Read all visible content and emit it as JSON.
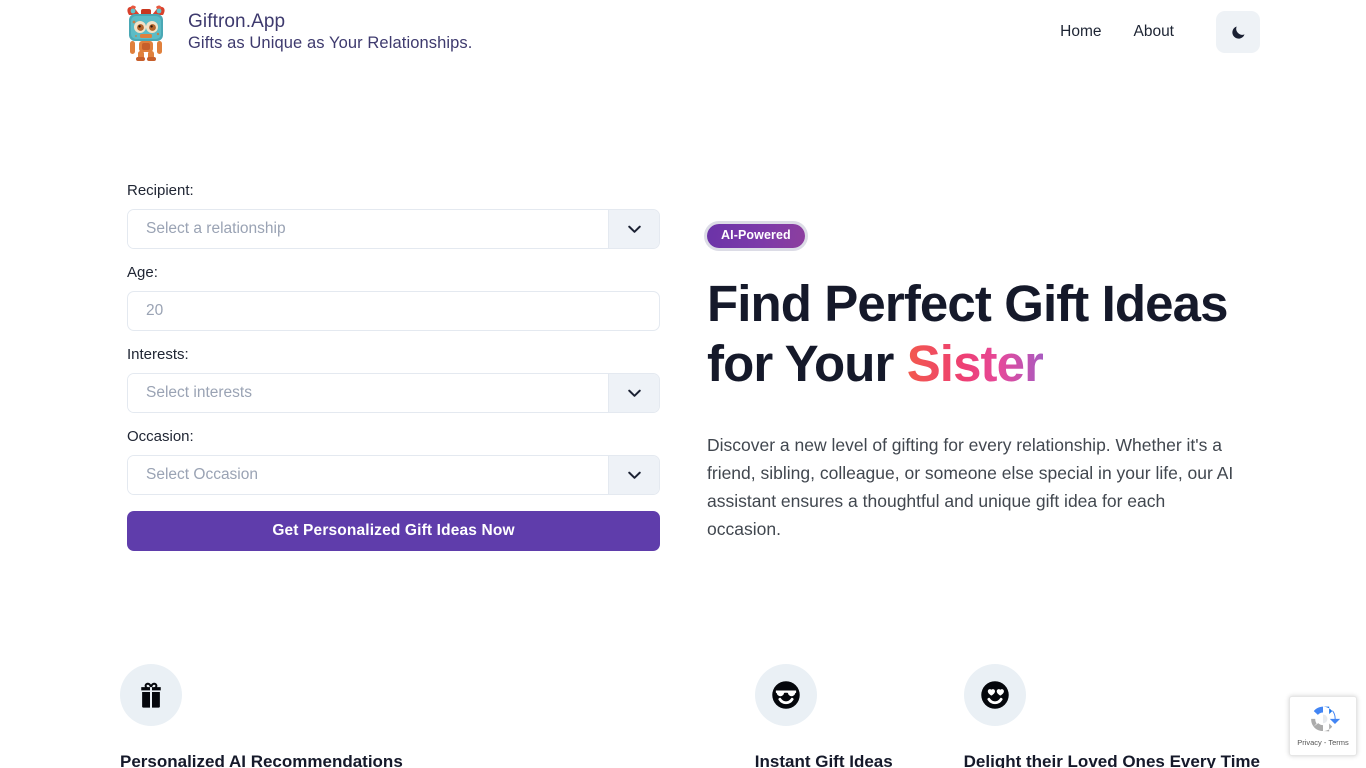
{
  "brand": {
    "title": "Giftron.App",
    "tagline": "Gifts as Unique as Your Relationships.",
    "logo_icon": "robot-gift-logo"
  },
  "nav": {
    "links": [
      {
        "label": "Home"
      },
      {
        "label": "About"
      }
    ],
    "theme_toggle_icon": "moon-icon"
  },
  "form": {
    "recipient": {
      "label": "Recipient:",
      "placeholder": "Select a relationship",
      "caret_icon": "chevron-down-icon"
    },
    "age": {
      "label": "Age:",
      "placeholder": "20",
      "value": ""
    },
    "interests": {
      "label": "Interests:",
      "placeholder": "Select interests",
      "caret_icon": "chevron-down-icon"
    },
    "occasion": {
      "label": "Occasion:",
      "placeholder": "Select Occasion",
      "caret_icon": "chevron-down-icon"
    },
    "submit_label": "Get Personalized Gift Ideas Now"
  },
  "hero": {
    "badge": "AI-Powered",
    "title_lead": "Find Perfect Gift Ideas for Your ",
    "title_accent": "Sister",
    "paragraph": "Discover a new level of gifting for every relationship. Whether it's a friend, sibling, colleague, or someone else special in your life, our AI assistant ensures a thoughtful and unique gift idea for each occasion."
  },
  "features": [
    {
      "icon": "gift-box-icon",
      "title": "Personalized AI Recommendations"
    },
    {
      "icon": "sunglasses-smiley-icon",
      "title": "Instant Gift Ideas"
    },
    {
      "icon": "heart-eyes-smiley-icon",
      "title": "Delight their Loved Ones Every Time"
    }
  ],
  "recaptcha": {
    "icon": "recaptcha-logo-icon",
    "links": "Privacy - Terms"
  },
  "colors": {
    "brand_text": "#3e3a6e",
    "primary_button": "#5f3dab",
    "badge_purple": "#7c3aa9",
    "accent_gradient_start": "#f2594d",
    "accent_gradient_end": "#a95bc0",
    "field_border": "#e4e9f0",
    "caret_bg": "#eef2f7",
    "feature_circle_bg": "#eaf0f5"
  }
}
